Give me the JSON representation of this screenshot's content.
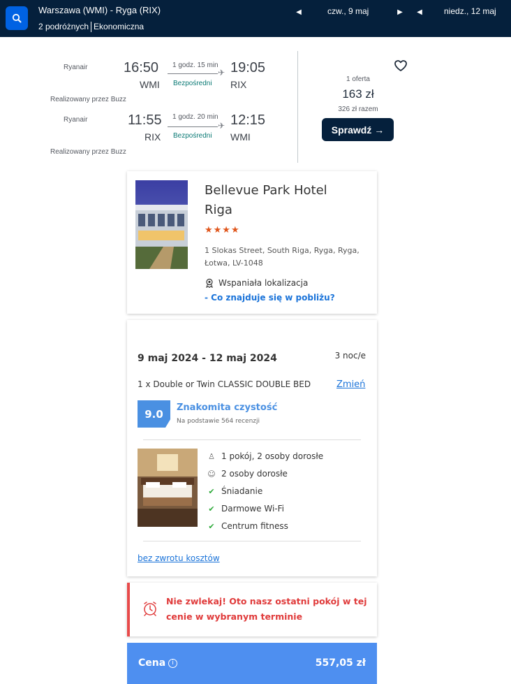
{
  "header": {
    "route": "Warszawa (WMI) - Ryga (RIX)",
    "travellers": "2 podróżnych",
    "cabin": "Ekonomiczna",
    "depart_date": "czw., 9 maj",
    "return_date": "niedz., 12 maj"
  },
  "flights": [
    {
      "airline": "Ryanair",
      "dep_time": "16:50",
      "dep_code": "WMI",
      "duration": "1 godz. 15 min",
      "stops": "Bezpośredni",
      "arr_time": "19:05",
      "arr_code": "RIX",
      "operated_by": "Realizowany przez Buzz"
    },
    {
      "airline": "Ryanair",
      "dep_time": "11:55",
      "dep_code": "RIX",
      "duration": "1 godz. 20 min",
      "stops": "Bezpośredni",
      "arr_time": "12:15",
      "arr_code": "WMI",
      "operated_by": "Realizowany przez Buzz"
    }
  ],
  "offer": {
    "count": "1 oferta",
    "price": "163 zł",
    "total": "326 zł razem",
    "button": "Sprawdź →"
  },
  "hotel": {
    "name": "Bellevue Park Hotel Riga",
    "stars": "★★★★",
    "address": "1 Slokas Street, South Riga, Ryga, Ryga, Łotwa, LV-1048",
    "location_label": "Wspaniała lokalizacja",
    "nearby_link": "- Co znajduje się w pobliżu?"
  },
  "room": {
    "dates": "9 maj 2024 - 12 maj 2024",
    "nights": "3 noc/e",
    "type": "1 x Double or Twin CLASSIC DOUBLE BED",
    "change_link": "Zmień",
    "score": "9.0",
    "score_label": "Znakomita czystość",
    "score_sub": "Na podstawie 564 recenzji",
    "amenities": [
      {
        "icon": "person-icon",
        "label": "1 pokój, 2 osoby dorosłe"
      },
      {
        "icon": "people-icon",
        "label": "2 osoby dorosłe"
      },
      {
        "icon": "check-icon",
        "label": "Śniadanie"
      },
      {
        "icon": "check-icon",
        "label": "Darmowe Wi-Fi"
      },
      {
        "icon": "check-icon",
        "label": "Centrum fitness"
      }
    ],
    "refund_link": "bez zwrotu kosztów"
  },
  "alert": {
    "text": "Nie zwlekaj! Oto nasz ostatni pokój w tej cenie w wybranym terminie"
  },
  "price": {
    "label": "Cena",
    "value": "557,05 zł"
  },
  "colors": {
    "topbar": "#05203c",
    "accent_blue": "#4e8ff0",
    "alert_red": "#e03b3b",
    "star_orange": "#e0561c",
    "check_green": "#2eaa3a"
  }
}
